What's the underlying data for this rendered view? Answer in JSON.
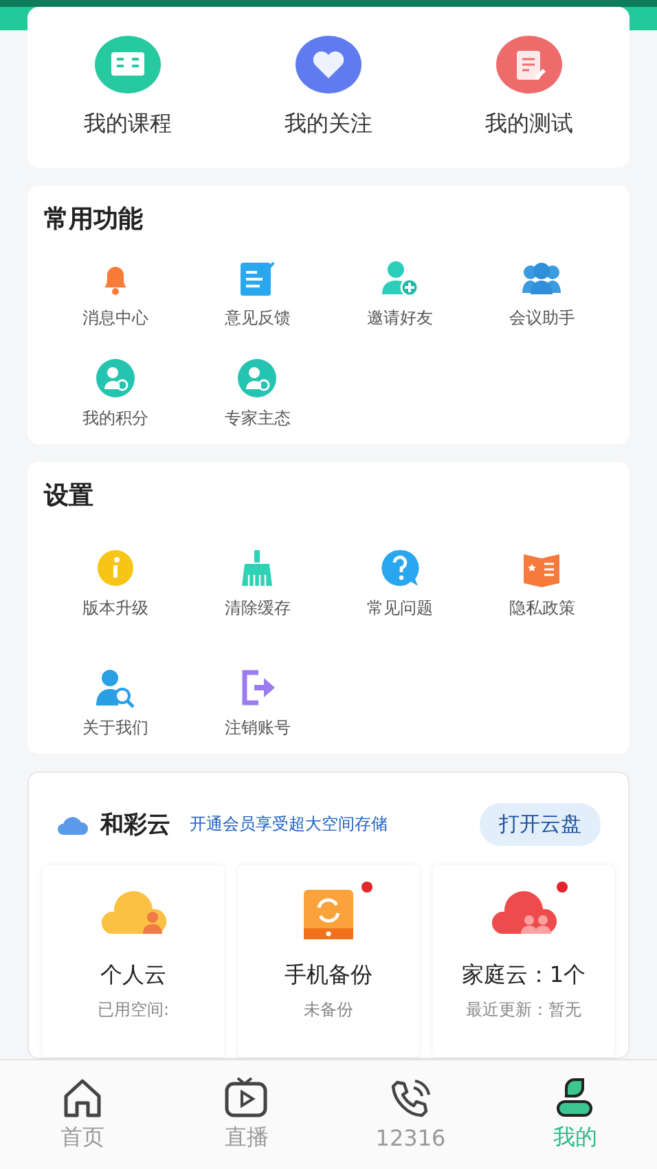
{
  "shortcuts": [
    {
      "label": "我的课程"
    },
    {
      "label": "我的关注"
    },
    {
      "label": "我的测试"
    }
  ],
  "common": {
    "title": "常用功能",
    "items": [
      {
        "label": "消息中心"
      },
      {
        "label": "意见反馈"
      },
      {
        "label": "邀请好友"
      },
      {
        "label": "会议助手"
      },
      {
        "label": "我的积分"
      },
      {
        "label": "专家主态"
      }
    ]
  },
  "settings": {
    "title": "设置",
    "items": [
      {
        "label": "版本升级"
      },
      {
        "label": "清除缓存"
      },
      {
        "label": "常见问题"
      },
      {
        "label": "隐私政策"
      },
      {
        "label": "关于我们"
      },
      {
        "label": "注销账号"
      }
    ]
  },
  "cloud": {
    "name": "和彩云",
    "promo": "开通会员享受超大空间存储",
    "button": "打开云盘",
    "items": [
      {
        "title": "个人云",
        "subtitle": "已用空间:",
        "unread": false
      },
      {
        "title": "手机备份",
        "subtitle": "未备份",
        "unread": true
      },
      {
        "title": "家庭云：1个",
        "subtitle": "最近更新：暂无",
        "unread": true
      }
    ]
  },
  "tabs": [
    {
      "label": "首页",
      "selected": false
    },
    {
      "label": "直播",
      "selected": false
    },
    {
      "label": "12316",
      "selected": false
    },
    {
      "label": "我的",
      "selected": true
    }
  ]
}
